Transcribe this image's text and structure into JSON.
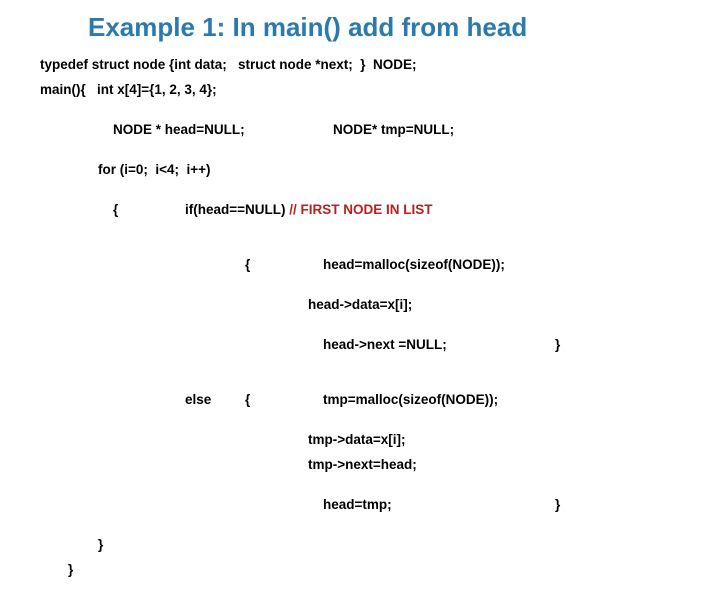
{
  "title": "Example 1: In main() add from head",
  "l1": "typedef struct node {int data;   struct node *next;  }  NODE;",
  "l2": "main(){   int x[4]={1, 2, 3, 4};",
  "l3a": "NODE * head=NULL;",
  "l3b": "NODE* tmp=NULL;",
  "l4": "for (i=0;  i<4;  i++)",
  "l5a": "{",
  "l5b": "if(head==NULL) ",
  "l5c": "// FIRST NODE IN LIST",
  "l6a": "{",
  "l6b": "head=malloc(sizeof(NODE));",
  "l7": "head->data=x[i];",
  "l8a": "head->next =NULL;",
  "l8b": "}",
  "l9a": "else",
  "l9b": "{",
  "l9c": "tmp=malloc(sizeof(NODE));",
  "l10": "tmp->data=x[i];",
  "l11": "tmp->next=head;",
  "l12a": "head=tmp;",
  "l12b": "}",
  "l13": "}",
  "l14": "}"
}
